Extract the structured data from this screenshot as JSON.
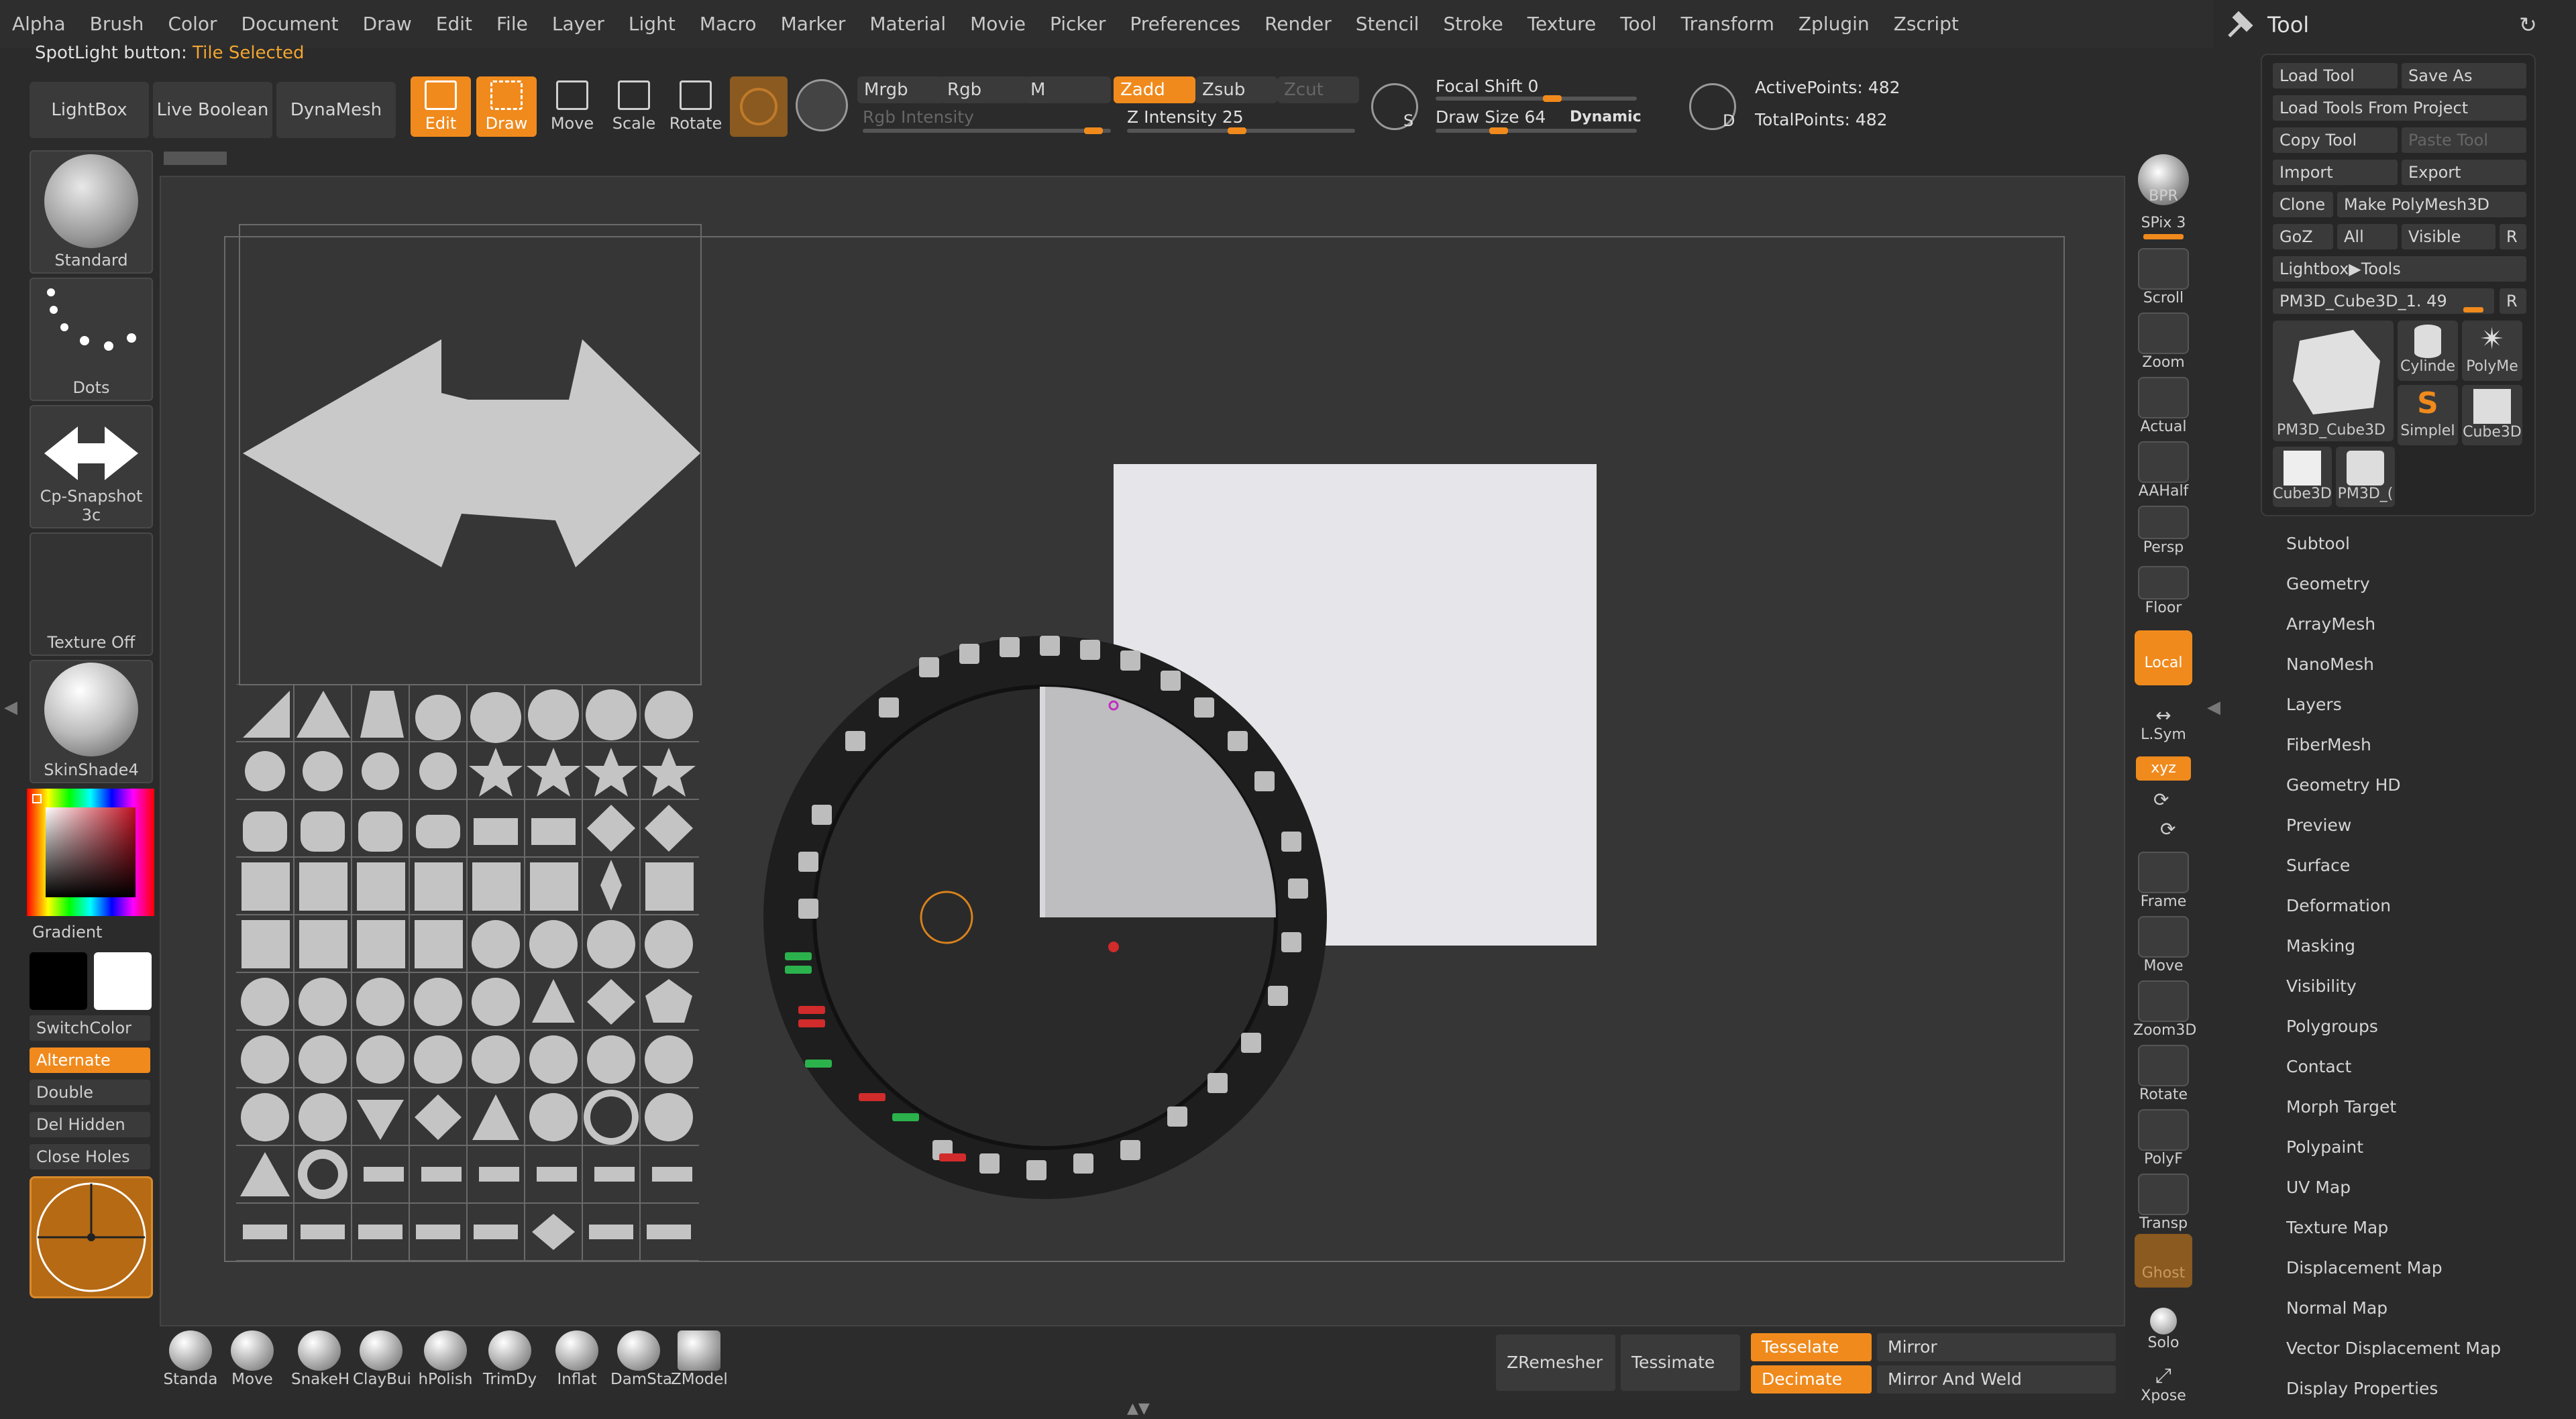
{
  "menu": [
    "Alpha",
    "Brush",
    "Color",
    "Document",
    "Draw",
    "Edit",
    "File",
    "Layer",
    "Light",
    "Macro",
    "Marker",
    "Material",
    "Movie",
    "Picker",
    "Preferences",
    "Render",
    "Stencil",
    "Stroke",
    "Texture",
    "Tool",
    "Transform",
    "Zplugin",
    "Zscript"
  ],
  "spotlight": {
    "label": "SpotLight button:",
    "value": "Tile Selected"
  },
  "top": {
    "lightbox": "LightBox",
    "live_boolean": "Live Boolean",
    "dynamesh": "DynaMesh",
    "edit": "Edit",
    "draw": "Draw",
    "move": "Move",
    "scale": "Scale",
    "rotate": "Rotate",
    "mrgb": "Mrgb",
    "rgb": "Rgb",
    "m": "M",
    "zadd": "Zadd",
    "zsub": "Zsub",
    "zcut": "Zcut",
    "rgb_intensity": "Rgb Intensity",
    "z_intensity_label": "Z Intensity",
    "z_intensity": "25",
    "focal_shift_label": "Focal Shift",
    "focal_shift": "0",
    "draw_size_label": "Draw Size",
    "draw_size": "64",
    "dynamic": "Dynamic",
    "active_points": "ActivePoints: 482",
    "total_points": "TotalPoints: 482",
    "s_label": "S",
    "d_label": "D"
  },
  "left": {
    "brush": "Standard",
    "stroke": "Dots",
    "alpha": "Cp-Snapshot 3c",
    "texture": "Texture Off",
    "material": "SkinShade4",
    "gradient": "Gradient",
    "switchcolor": "SwitchColor",
    "alternate": "Alternate",
    "double": "Double",
    "del_hidden": "Del Hidden",
    "close_holes": "Close Holes"
  },
  "shelf": [
    "BPR",
    "SPix 3",
    "Scroll",
    "Zoom",
    "Actual",
    "AAHalf",
    "Persp",
    "Floor",
    "Local",
    "L.Sym",
    "Frame",
    "Move",
    "Zoom3D",
    "Rotate",
    "PolyF",
    "Transp",
    "Ghost",
    "Solo",
    "Xpose"
  ],
  "tool": {
    "title": "Tool",
    "load_tool": "Load Tool",
    "save_as": "Save As",
    "load_from_project": "Load Tools From Project",
    "copy_tool": "Copy Tool",
    "paste_tool": "Paste Tool",
    "import": "Import",
    "export": "Export",
    "clone": "Clone",
    "make_polymesh": "Make PolyMesh3D",
    "goz": "GoZ",
    "all": "All",
    "visible": "Visible",
    "r": "R",
    "lightbox_tools": "Lightbox▶Tools",
    "current": "PM3D_Cube3D_1. 49",
    "thumbs": [
      "PM3D_Cube3D",
      "Cylinde",
      "PolyMe",
      "SimpleI",
      "Cube3D",
      "Cube3D",
      "PM3D_("
    ],
    "subpalettes": [
      "Subtool",
      "Geometry",
      "ArrayMesh",
      "NanoMesh",
      "Layers",
      "FiberMesh",
      "Geometry HD",
      "Preview",
      "Surface",
      "Deformation",
      "Masking",
      "Visibility",
      "Polygroups",
      "Contact",
      "Morph Target",
      "Polypaint",
      "UV Map",
      "Texture Map",
      "Displacement Map",
      "Normal Map",
      "Vector Displacement Map",
      "Display Properties"
    ]
  },
  "bottom": {
    "brushes": [
      "Standa",
      "Move",
      "SnakeH",
      "ClayBui",
      "hPolish",
      "TrimDy",
      "Inflat",
      "DamSta",
      "ZModel"
    ],
    "zremesher": "ZRemesher",
    "tessimate": "Tessimate",
    "tesselate": "Tesselate",
    "decimate": "Decimate",
    "mirror": "Mirror",
    "mirror_weld": "Mirror And Weld"
  },
  "colors": {
    "accent": "#f08a1c",
    "panel": "#3a3a3a",
    "bg": "#2b2b2b"
  }
}
